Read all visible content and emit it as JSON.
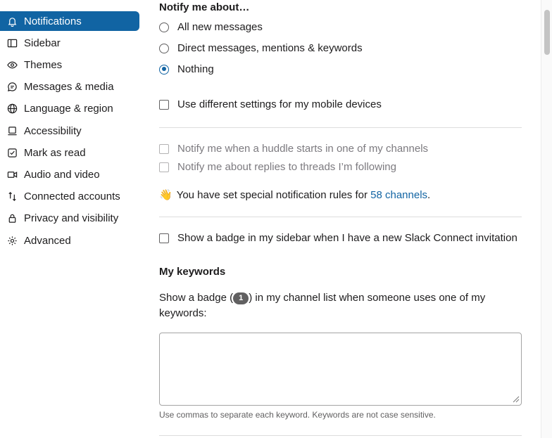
{
  "sidebar": {
    "items": [
      {
        "label": "Notifications",
        "icon": "bell-icon"
      },
      {
        "label": "Sidebar",
        "icon": "sidebar-icon"
      },
      {
        "label": "Themes",
        "icon": "eye-icon"
      },
      {
        "label": "Messages & media",
        "icon": "message-icon"
      },
      {
        "label": "Language & region",
        "icon": "globe-icon"
      },
      {
        "label": "Accessibility",
        "icon": "accessibility-icon"
      },
      {
        "label": "Mark as read",
        "icon": "check-icon"
      },
      {
        "label": "Audio and video",
        "icon": "video-icon"
      },
      {
        "label": "Connected accounts",
        "icon": "arrows-icon"
      },
      {
        "label": "Privacy and visibility",
        "icon": "lock-icon"
      },
      {
        "label": "Advanced",
        "icon": "gear-icon"
      }
    ]
  },
  "notify": {
    "heading": "Notify me about…",
    "options": [
      "All new messages",
      "Direct messages, mentions & keywords",
      "Nothing"
    ],
    "selected": "Nothing"
  },
  "mobile": {
    "label": "Use different settings for my mobile devices"
  },
  "huddle": {
    "label": "Notify me when a huddle starts in one of my channels"
  },
  "threads": {
    "label": "Notify me about replies to threads I’m following"
  },
  "special": {
    "emoji": "👋",
    "text": "You have set special notification rules for ",
    "link": "58 channels",
    "suffix": "."
  },
  "connect_badge": {
    "label": "Show a badge in my sidebar when I have a new Slack Connect invitation"
  },
  "keywords": {
    "heading": "My keywords",
    "desc_before": "Show a badge (",
    "badge": "1",
    "desc_after": ") in my channel list when someone uses one of my keywords:",
    "value": "",
    "help": "Use commas to separate each keyword. Keywords are not case sensitive."
  },
  "colors": {
    "accent": "#1164a3",
    "link": "#1264a3"
  }
}
